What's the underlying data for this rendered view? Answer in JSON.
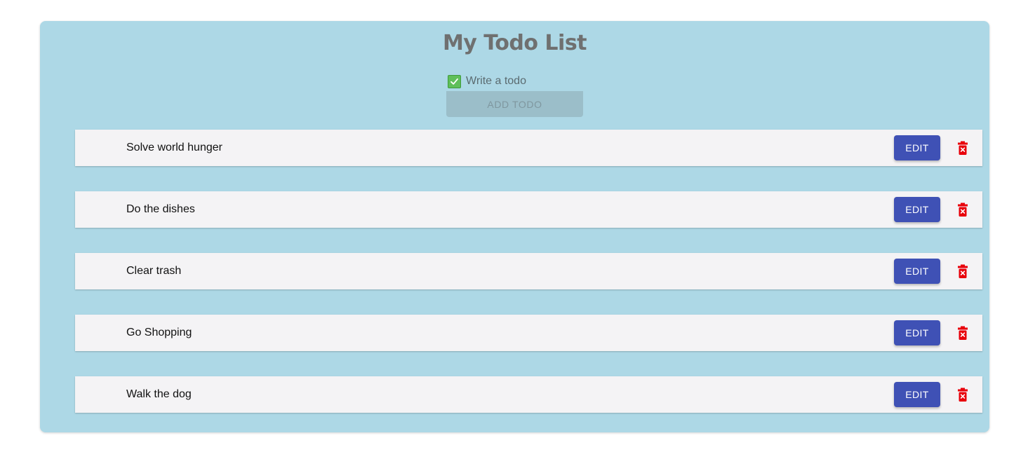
{
  "header": {
    "title": "My Todo List"
  },
  "form": {
    "placeholder": "Write a todo",
    "value": "",
    "add_label": "ADD TODO"
  },
  "todos": [
    {
      "text": "Solve world hunger",
      "edit_label": "EDIT"
    },
    {
      "text": "Do the dishes",
      "edit_label": "EDIT"
    },
    {
      "text": "Clear trash",
      "edit_label": "EDIT"
    },
    {
      "text": "Go Shopping",
      "edit_label": "EDIT"
    },
    {
      "text": "Walk the dog",
      "edit_label": "EDIT"
    }
  ],
  "icons": {
    "input": "check-mark-icon",
    "delete": "trash-icon"
  },
  "colors": {
    "card_background": "#add8e6",
    "edit_button": "#3f51b5",
    "delete_icon": "#e8000b",
    "checkbox": "#5fbf5a"
  }
}
